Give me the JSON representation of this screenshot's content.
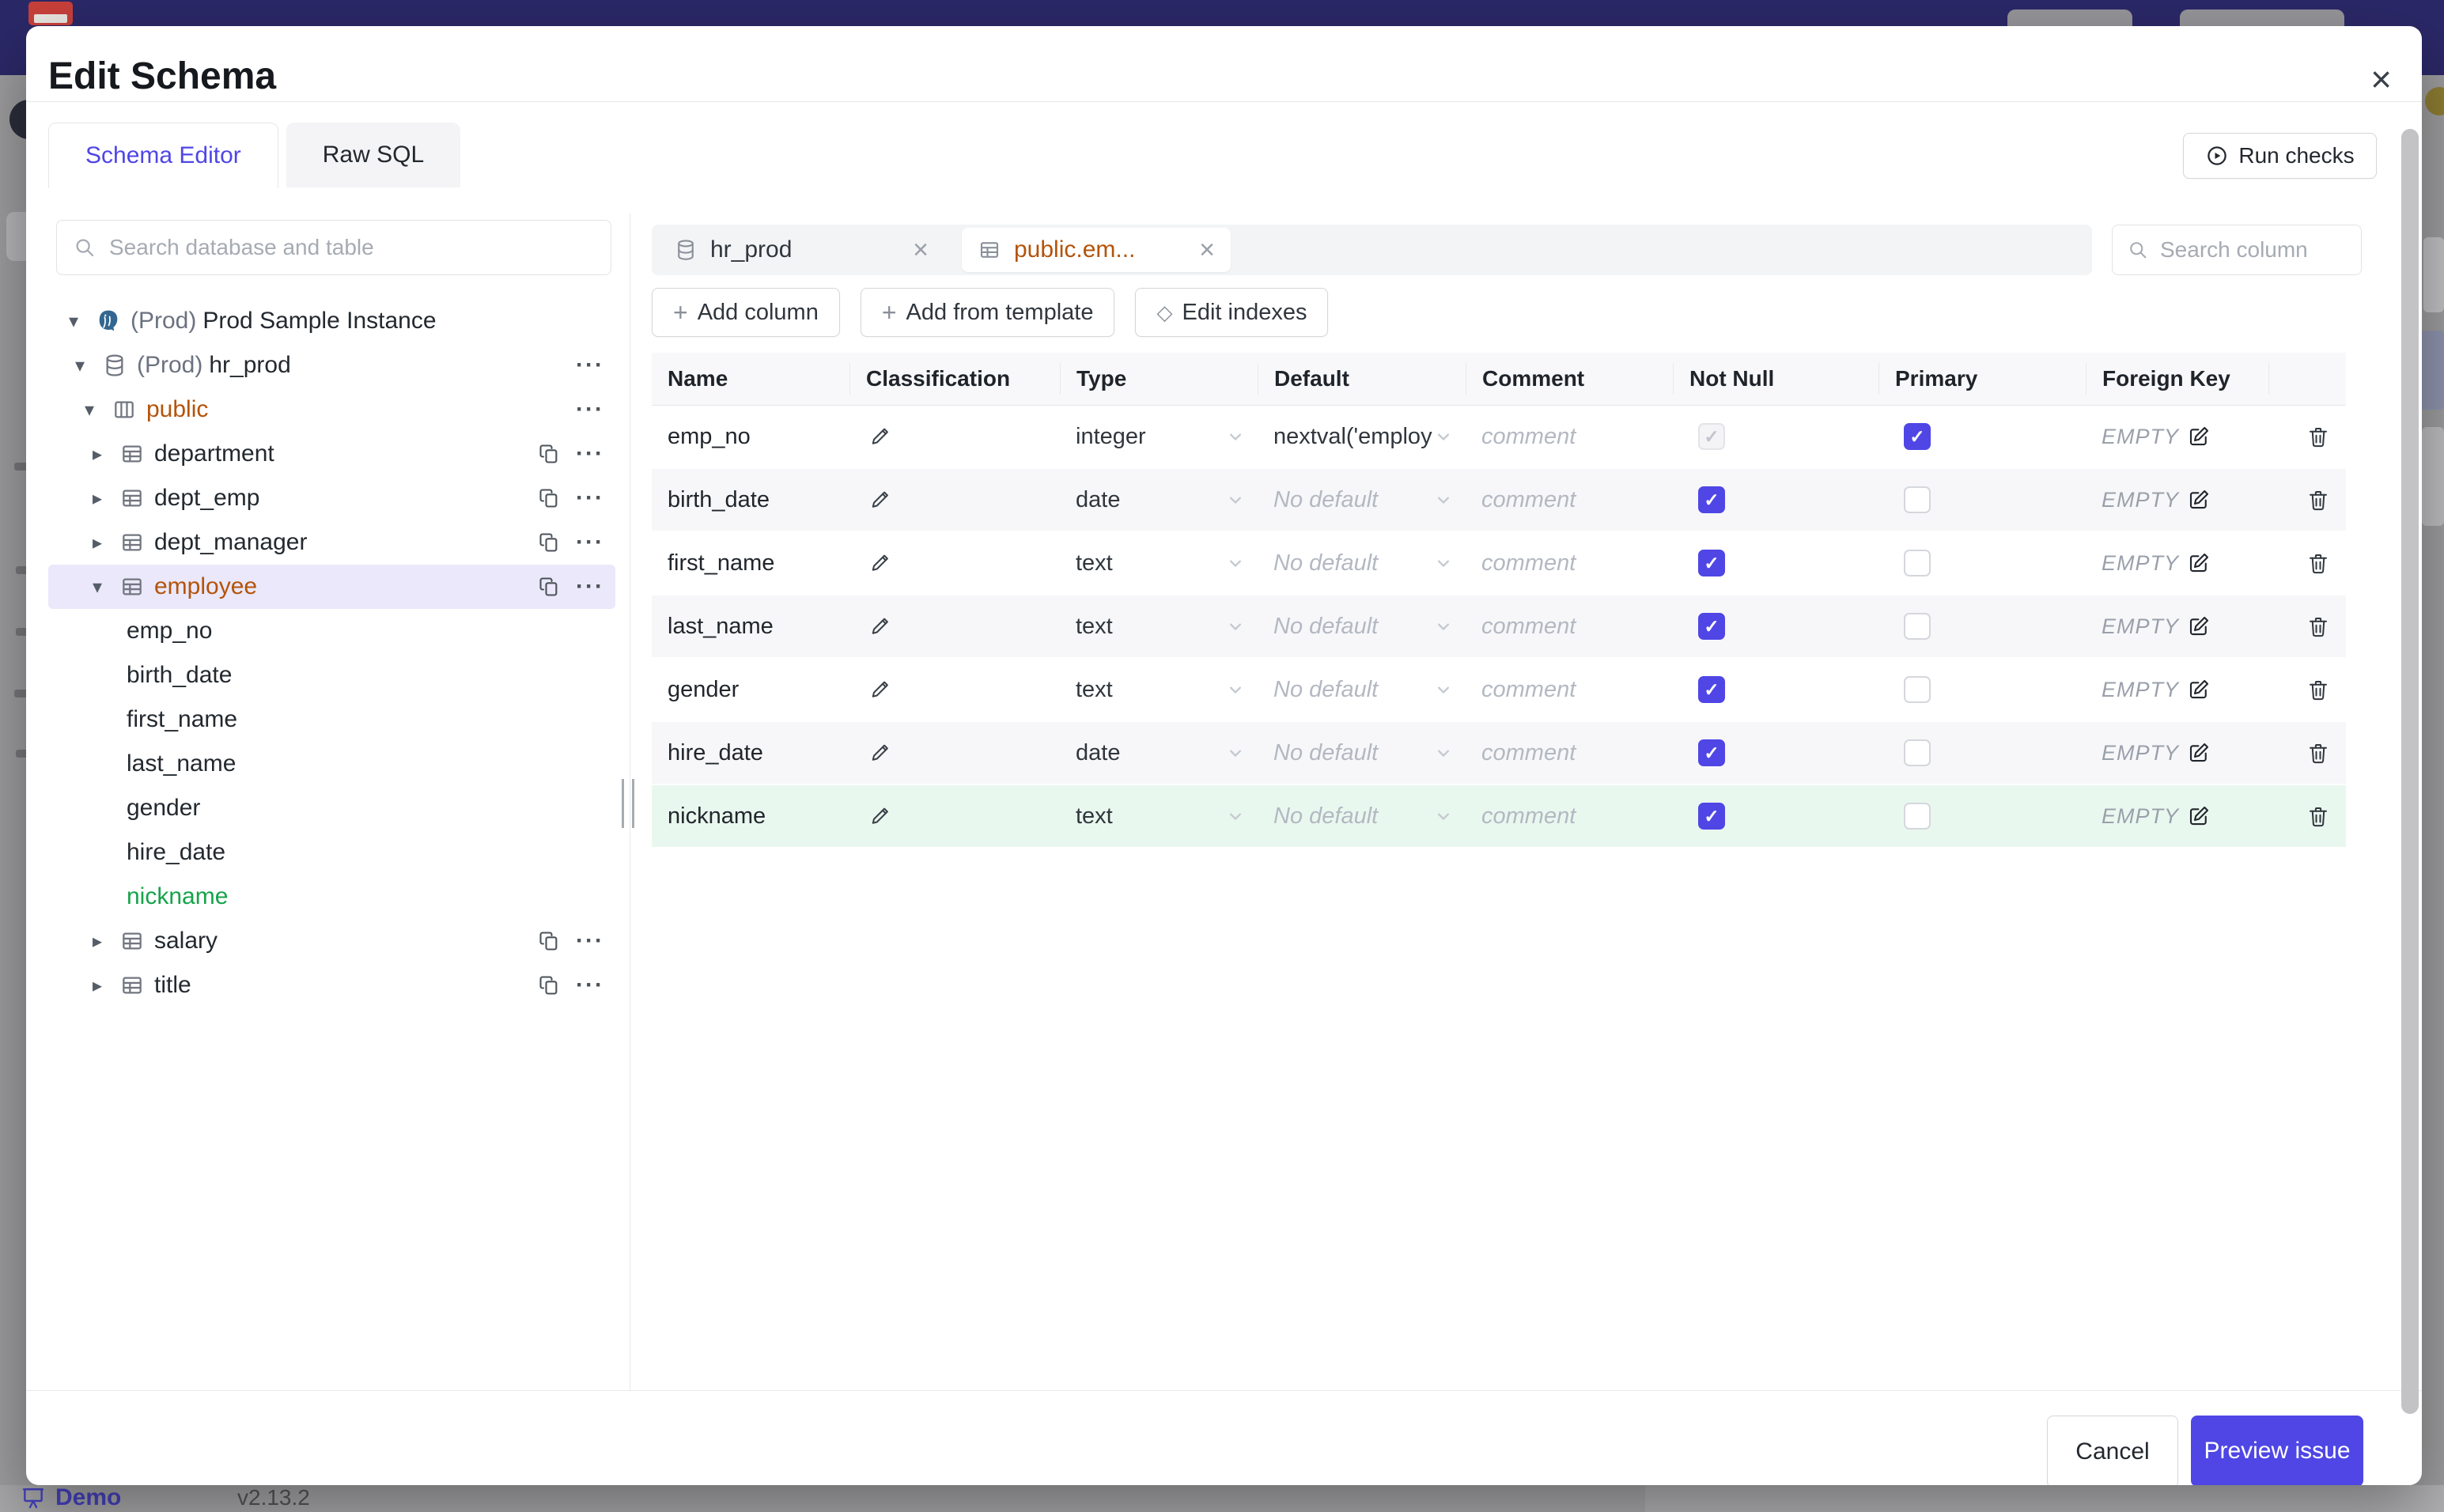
{
  "colors": {
    "accent": "#4f46e5",
    "highlight_orange": "#b45309",
    "new_item_green": "#16a34a",
    "selected_tree_bg": "#eae8fa",
    "new_row_bg": "#e9f8ef",
    "navbar_bg": "#2b2868"
  },
  "chrome": {
    "demo_label": "Demo",
    "version": "v2.13.2"
  },
  "modal": {
    "title": "Edit Schema",
    "close_glyph": "×",
    "tabs": [
      {
        "label": "Schema Editor",
        "active": true
      },
      {
        "label": "Raw SQL",
        "active": false
      }
    ],
    "run_checks_label": "Run checks",
    "sidebar": {
      "search_placeholder": "Search database and table",
      "tree": [
        {
          "kind": "instance",
          "level": 0,
          "caret": "down",
          "icon": "postgresql",
          "prefix": "(Prod)",
          "label": "Prod Sample Instance"
        },
        {
          "kind": "database",
          "level": 1,
          "caret": "down",
          "icon": "database",
          "prefix": "(Prod)",
          "label": "hr_prod",
          "menu": true
        },
        {
          "kind": "schema",
          "level": 2,
          "caret": "down",
          "icon": "schema",
          "label": "public",
          "color": "orange",
          "menu": true
        },
        {
          "kind": "table",
          "level": 3,
          "caret": "right",
          "icon": "table",
          "label": "department",
          "copy": true,
          "menu": true
        },
        {
          "kind": "table",
          "level": 3,
          "caret": "right",
          "icon": "table",
          "label": "dept_emp",
          "copy": true,
          "menu": true
        },
        {
          "kind": "table",
          "level": 3,
          "caret": "right",
          "icon": "table",
          "label": "dept_manager",
          "copy": true,
          "menu": true
        },
        {
          "kind": "table",
          "level": 3,
          "caret": "down",
          "icon": "table",
          "label": "employee",
          "color": "orange",
          "selected": true,
          "copy": true,
          "menu": true
        },
        {
          "kind": "column",
          "level": 4,
          "label": "emp_no"
        },
        {
          "kind": "column",
          "level": 4,
          "label": "birth_date"
        },
        {
          "kind": "column",
          "level": 4,
          "label": "first_name"
        },
        {
          "kind": "column",
          "level": 4,
          "label": "last_name"
        },
        {
          "kind": "column",
          "level": 4,
          "label": "gender"
        },
        {
          "kind": "column",
          "level": 4,
          "label": "hire_date"
        },
        {
          "kind": "column",
          "level": 4,
          "label": "nickname",
          "color": "green"
        },
        {
          "kind": "table",
          "level": 3,
          "caret": "right",
          "icon": "table",
          "label": "salary",
          "copy": true,
          "menu": true
        },
        {
          "kind": "table",
          "level": 3,
          "caret": "right",
          "icon": "table",
          "label": "title",
          "copy": true,
          "menu": true
        }
      ]
    },
    "editor": {
      "chips": [
        {
          "label": "hr_prod",
          "icon": "database",
          "active": false
        },
        {
          "label": "public.em...",
          "icon": "table",
          "active": true
        }
      ],
      "column_search_placeholder": "Search column",
      "toolbar": [
        {
          "label": "Add column",
          "icon": "plus"
        },
        {
          "label": "Add from template",
          "icon": "plus"
        },
        {
          "label": "Edit indexes",
          "icon": "diamond"
        }
      ],
      "grid": {
        "headers": [
          "Name",
          "Classification",
          "Type",
          "Default",
          "Comment",
          "Not Null",
          "Primary",
          "Foreign Key",
          ""
        ],
        "rows": [
          {
            "name": "emp_no",
            "type": "integer",
            "default": "nextval('employ",
            "default_is_placeholder": false,
            "comment_placeholder": "comment",
            "not_null": "checked-disabled",
            "primary": "checked",
            "foreign_key": "EMPTY",
            "state": "existing"
          },
          {
            "name": "birth_date",
            "type": "date",
            "default": "No default",
            "default_is_placeholder": true,
            "comment_placeholder": "comment",
            "not_null": "checked",
            "primary": "unchecked",
            "foreign_key": "EMPTY",
            "state": "existing"
          },
          {
            "name": "first_name",
            "type": "text",
            "default": "No default",
            "default_is_placeholder": true,
            "comment_placeholder": "comment",
            "not_null": "checked",
            "primary": "unchecked",
            "foreign_key": "EMPTY",
            "state": "existing"
          },
          {
            "name": "last_name",
            "type": "text",
            "default": "No default",
            "default_is_placeholder": true,
            "comment_placeholder": "comment",
            "not_null": "checked",
            "primary": "unchecked",
            "foreign_key": "EMPTY",
            "state": "existing"
          },
          {
            "name": "gender",
            "type": "text",
            "default": "No default",
            "default_is_placeholder": true,
            "comment_placeholder": "comment",
            "not_null": "checked",
            "primary": "unchecked",
            "foreign_key": "EMPTY",
            "state": "existing"
          },
          {
            "name": "hire_date",
            "type": "date",
            "default": "No default",
            "default_is_placeholder": true,
            "comment_placeholder": "comment",
            "not_null": "checked",
            "primary": "unchecked",
            "foreign_key": "EMPTY",
            "state": "existing"
          },
          {
            "name": "nickname",
            "type": "text",
            "default": "No default",
            "default_is_placeholder": true,
            "comment_placeholder": "comment",
            "not_null": "checked",
            "primary": "unchecked",
            "foreign_key": "EMPTY",
            "state": "new"
          }
        ]
      }
    },
    "footer": {
      "cancel_label": "Cancel",
      "submit_label": "Preview issue"
    }
  }
}
